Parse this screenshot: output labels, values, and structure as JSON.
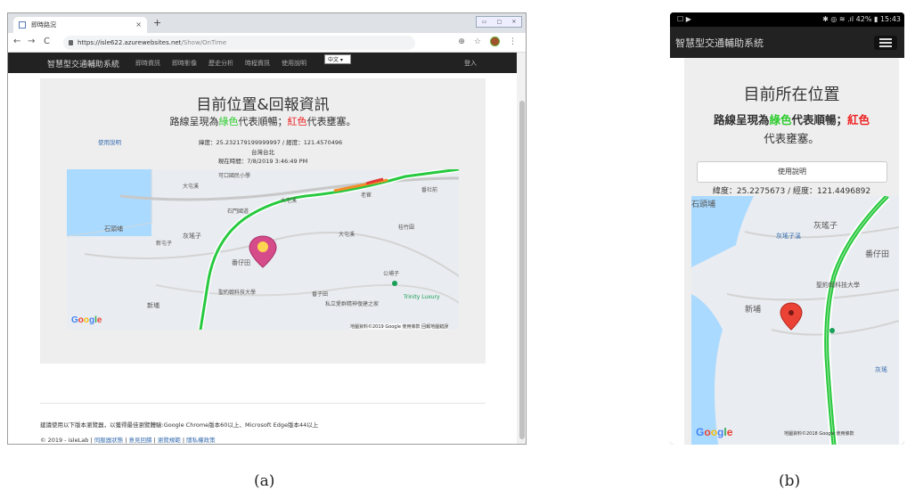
{
  "panel_a": {
    "tab_title": "即時路況",
    "tab_close": "×",
    "new_tab": "+",
    "window_controls": [
      "▭",
      "□",
      "✕"
    ],
    "nav_back": "←",
    "nav_forward": "→",
    "nav_reload": "C",
    "url_host": "https://isle622.azurewebsites.net",
    "url_path": "/Show/OnTime",
    "toolbar_icons": [
      "⊕",
      "☆",
      "⋮"
    ],
    "app_brand": "智慧型交通輔助系統",
    "nav_links": [
      "即時資訊",
      "即時影像",
      "歷史分析",
      "時程資訊",
      "使用說明"
    ],
    "language": "中文 ▾",
    "login": "登入",
    "title": "目前位置&回報資訊",
    "subtitle_prefix": "路線呈現為",
    "subtitle_green": "綠色",
    "subtitle_mid": "代表順暢；",
    "subtitle_red": "紅色",
    "subtitle_suffix": "代表壅塞。",
    "help_link": "使用說明",
    "coordinates": "緯度：25.232179199999997 / 經度：121.4570496",
    "city": "台灣台北",
    "time": "現在時間：7/8/2019 3:46:49 PM",
    "map_labels": [
      "可口國民小學",
      "大屯溪",
      "石門國道",
      "大宅溪",
      "新屯子",
      "灰瑤子",
      "石頭埔",
      "番仔田",
      "番子田",
      "公埔子",
      "聖約翰科技大學",
      "新埔",
      "老崔",
      "番社前",
      "桂竹圍",
      "私立愛群精神復建之家",
      "Trinity Luxury",
      "大屯溪"
    ],
    "map_attribution": "地圖資料©2019 Google  使用條款  回報地圖錯誤",
    "footer_line1": "建議使用以下版本瀏覽器，以獲得最佳瀏覽體驗:Google Chrome版本60以上、Microsoft Edge版本44以上",
    "footer_line2_prefix": "© 2019 - isleLab | ",
    "footer_links": [
      "伺服器狀態",
      "意見回饋",
      "瀏覽規範",
      "隱私權政策"
    ],
    "caption": "(a)"
  },
  "panel_b": {
    "status_left": "☐ ▶",
    "status_right": "✱ ◎ ≋ .ıl 42% ▮ 15:43",
    "app_brand": "智慧型交通輔助系統",
    "title": "目前所在位置",
    "subtitle_line1_prefix": "路線呈現為",
    "subtitle_green": "綠色",
    "subtitle_mid": "代表順暢；",
    "subtitle_red": "紅色",
    "subtitle_line2": "代表壅塞。",
    "help_button": "使用說明",
    "coordinates": "緯度：25.2275673 / 經度：121.4496892",
    "map_labels": [
      "石頭埔",
      "灰瑤子溪",
      "灰瑤子",
      "番仔田",
      "聖約翰科技大學",
      "新埔",
      "灰瑤"
    ],
    "map_attribution": "地圖資料©2018 Google  使用條款",
    "caption": "(b)"
  },
  "colors": {
    "navbar": "#222222",
    "jumbotron": "#eeeeee",
    "route_green": "#2ecc2e",
    "congestion_red": "#ee2222",
    "link_blue": "#3a6fb0"
  }
}
